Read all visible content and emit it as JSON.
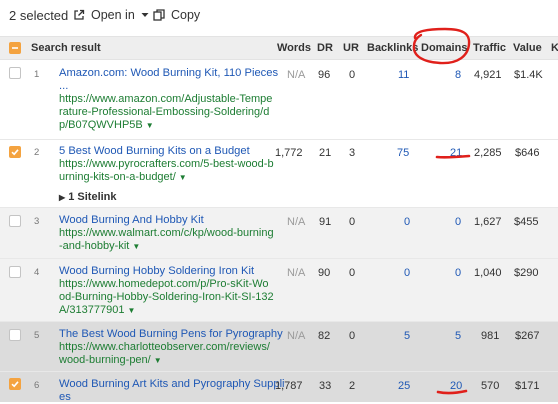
{
  "toolbar": {
    "selected": "2 selected",
    "open_in": "Open in",
    "copy": "Copy"
  },
  "headers": {
    "search_result": "Search result",
    "words": "Words",
    "dr": "DR",
    "ur": "UR",
    "backlinks": "Backlinks",
    "domains": "Domains",
    "traffic": "Traffic",
    "value": "Value",
    "extra": "K"
  },
  "rows": [
    {
      "num": "1",
      "title": "Amazon.com: Wood Burning Kit, 110 Pieces",
      "title2": "...",
      "url": "https://www.amazon.com/Adjustable-Temperature-Professional-Embossing-Soldering/dp/B07QWVHP5B",
      "words": "N/A",
      "dr": "96",
      "ur": "0",
      "backlinks": "11",
      "domains": "8",
      "traffic": "4,921",
      "value": "$1.4K",
      "checked": false
    },
    {
      "num": "2",
      "title": "5 Best Wood Burning Kits on a Budget",
      "url": "https://www.pyrocrafters.com/5-best-wood-burning-kits-on-a-budget/",
      "words": "1,772",
      "dr": "21",
      "ur": "3",
      "backlinks": "75",
      "domains": "21",
      "traffic": "2,285",
      "value": "$646",
      "checked": true,
      "sitelink": "1 Sitelink"
    },
    {
      "num": "3",
      "title": "Wood Burning And Hobby Kit",
      "url": "https://www.walmart.com/c/kp/wood-burning-and-hobby-kit",
      "words": "N/A",
      "dr": "91",
      "ur": "0",
      "backlinks": "0",
      "domains": "0",
      "traffic": "1,627",
      "value": "$455",
      "checked": false
    },
    {
      "num": "4",
      "title": "Wood Burning Hobby Soldering Iron Kit",
      "url": "https://www.homedepot.com/p/Pro-sKit-Wood-Burning-Hobby-Soldering-Iron-Kit-SI-132A/313777901",
      "words": "N/A",
      "dr": "90",
      "ur": "0",
      "backlinks": "0",
      "domains": "0",
      "traffic": "1,040",
      "value": "$290",
      "checked": false
    },
    {
      "num": "5",
      "title": "The Best Wood Burning Pens for Pyrography",
      "url": "https://www.charlotteobserver.com/reviews/wood-burning-pen/",
      "words": "N/A",
      "dr": "82",
      "ur": "0",
      "backlinks": "5",
      "domains": "5",
      "traffic": "981",
      "value": "$267",
      "checked": false
    },
    {
      "num": "6",
      "title": "Wood Burning Art Kits and Pyrography Suppli",
      "title2": "es",
      "words": "1,787",
      "dr": "33",
      "ur": "2",
      "backlinks": "25",
      "domains": "20",
      "traffic": "570",
      "value": "$171",
      "checked": true
    }
  ],
  "colors": {
    "link_blue": "#1f58b5",
    "url_green": "#1d7d33",
    "checkbox_orange": "#f4a340",
    "annotation_red": "#e0201b"
  }
}
